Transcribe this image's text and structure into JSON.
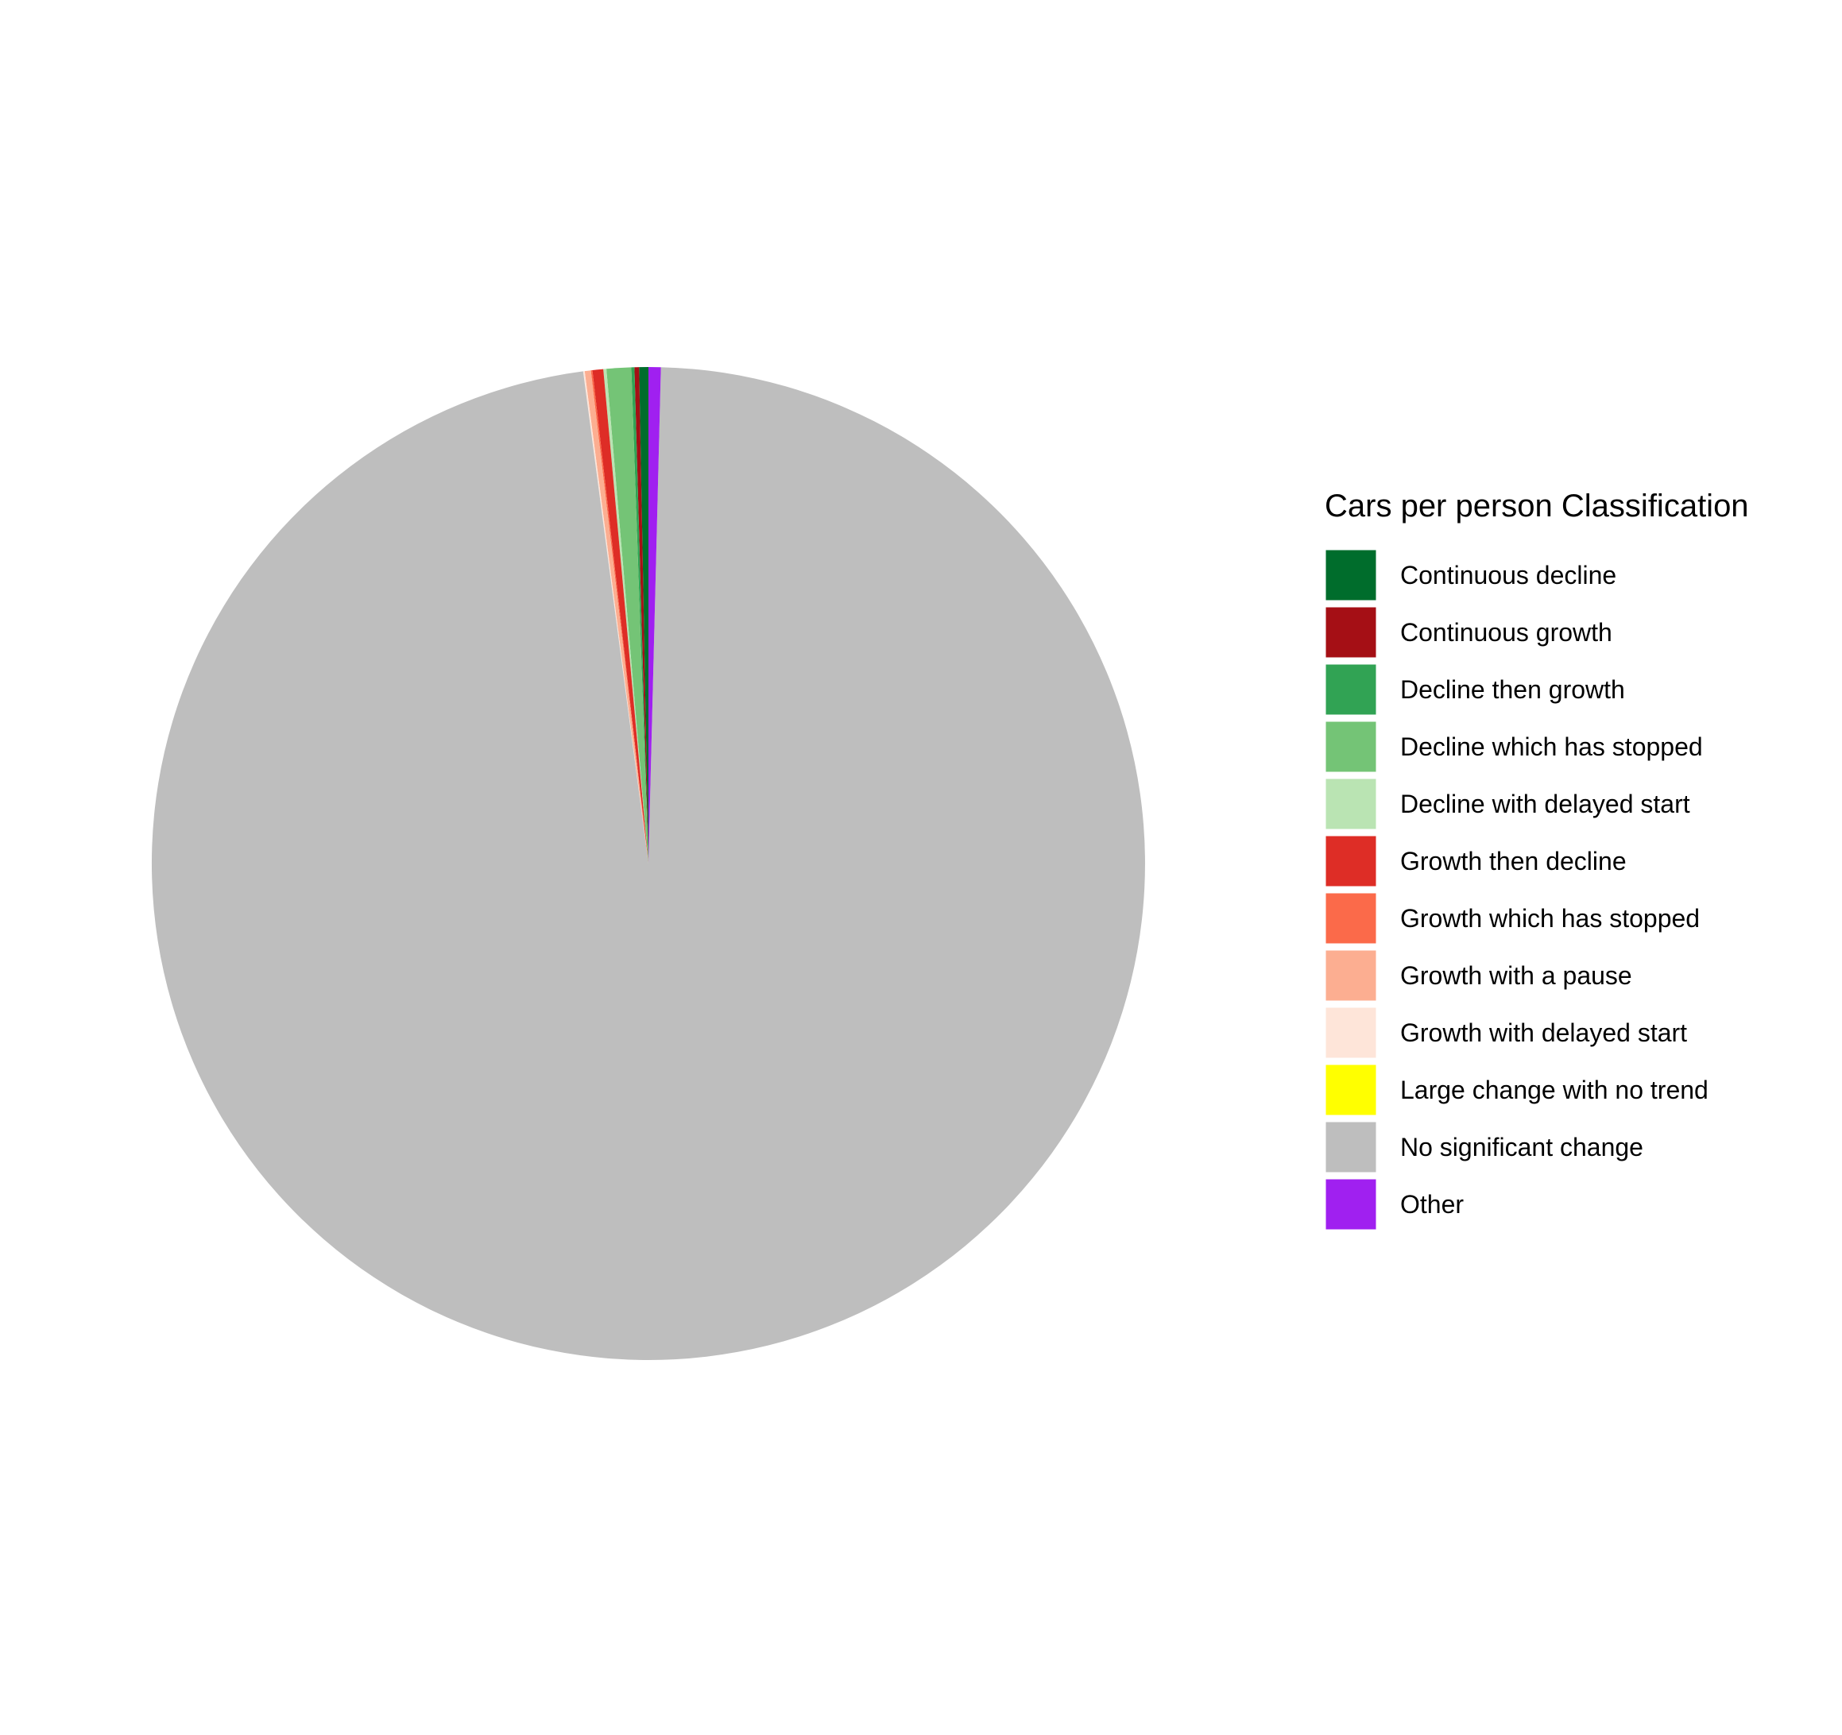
{
  "chart_data": {
    "type": "pie",
    "legend": {
      "title": "Cars per person Classification",
      "position": "right"
    },
    "start_angle_deg": 0,
    "direction": "counterclockwise",
    "slices": [
      {
        "label": "Continuous decline",
        "value": 0.3,
        "color": "#006d2c"
      },
      {
        "label": "Continuous growth",
        "value": 0.15,
        "color": "#a50f15"
      },
      {
        "label": "Decline then growth",
        "value": 0.1,
        "color": "#31a354"
      },
      {
        "label": "Decline which has stopped",
        "value": 0.8,
        "color": "#74c476"
      },
      {
        "label": "Decline with delayed start",
        "value": 0.1,
        "color": "#bae4b3"
      },
      {
        "label": "Growth then decline",
        "value": 0.35,
        "color": "#de2d26"
      },
      {
        "label": "Growth which has stopped",
        "value": 0.05,
        "color": "#fb6a4a"
      },
      {
        "label": "Growth with a pause",
        "value": 0.2,
        "color": "#fcae91"
      },
      {
        "label": "Growth with delayed start",
        "value": 0.05,
        "color": "#fee5d9"
      },
      {
        "label": "Large change with no trend",
        "value": 0.0,
        "color": "#ffff00"
      },
      {
        "label": "No significant change",
        "value": 97.5,
        "color": "#bebebe"
      },
      {
        "label": "Other",
        "value": 0.4,
        "color": "#a020f0"
      }
    ]
  }
}
